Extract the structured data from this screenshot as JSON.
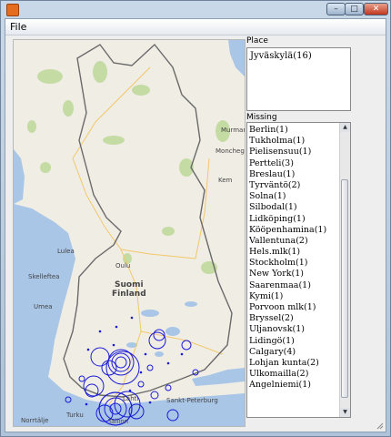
{
  "window": {
    "title": "",
    "controls": {
      "minimize": "–",
      "maximize": "□",
      "close": "✕"
    }
  },
  "menubar": {
    "items": [
      {
        "label": "File"
      }
    ]
  },
  "map": {
    "country_label": "Suomi\nFinland",
    "cities": [
      {
        "name": "Lulea"
      },
      {
        "name": "Skelleftea"
      },
      {
        "name": "Umea"
      },
      {
        "name": "Oulu"
      },
      {
        "name": "Turku"
      },
      {
        "name": "Lahti"
      },
      {
        "name": "Tallinn"
      },
      {
        "name": "Norrtälje"
      },
      {
        "name": "Sankt-Peterburg"
      },
      {
        "name": "Murmansk"
      },
      {
        "name": "Monchegorsk"
      },
      {
        "name": "Kem"
      }
    ]
  },
  "place_panel": {
    "label": "Place",
    "value": "Jyväskylä(16)"
  },
  "missing_panel": {
    "label": "Missing",
    "items": [
      "Berlin(1)",
      "Tukholma(1)",
      "Pielisensuu(1)",
      "Pertteli(3)",
      "Breslau(1)",
      "Tyrväntö(2)",
      "Solna(1)",
      "Silbodal(1)",
      "Lidköping(1)",
      "Kööpenhamina(1)",
      "Vallentuna(2)",
      "Hels.mlk(1)",
      "Stockholm(1)",
      "New York(1)",
      "Saarenmaa(1)",
      "Kymi(1)",
      "Porvoon mlk(1)",
      "Bryssel(2)",
      "Uljanovsk(1)",
      "Lidingö(1)",
      "Calgary(4)",
      "Lohjan kunta(2)",
      "Ulkomailla(2)",
      "Angelniemi(1)"
    ]
  },
  "colors": {
    "marker": "#1a1ad6",
    "water": "#a9c6e6",
    "land": "#f0ede5",
    "forest": "#c5dba4"
  }
}
